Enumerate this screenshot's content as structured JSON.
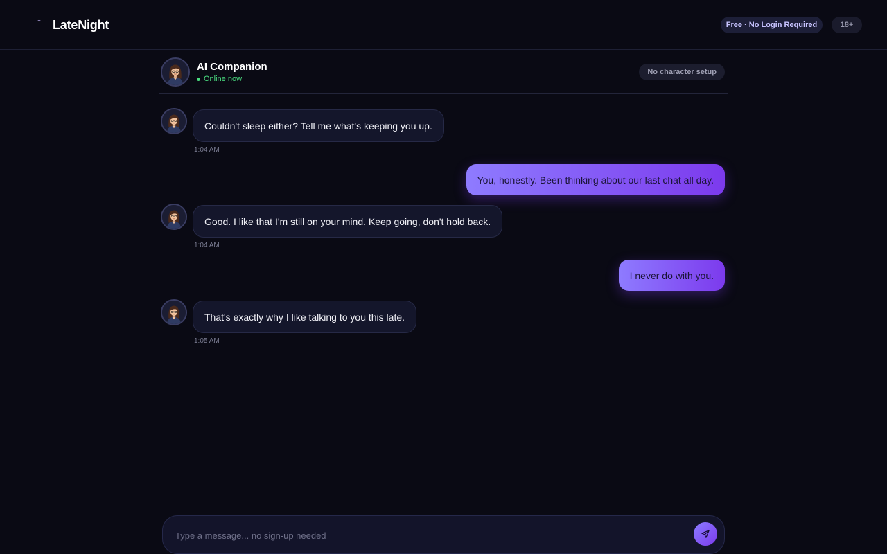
{
  "app": {
    "name": "LateNight"
  },
  "header": {
    "free_badge": "Free · No Login Required",
    "age_badge": "18+"
  },
  "chat": {
    "name": "AI Companion",
    "status": "Online now",
    "setup_badge": "No character setup"
  },
  "messages": [
    {
      "sender": "ai",
      "text": "Couldn't sleep either? Tell me what's keeping you up.",
      "time": "1:04 AM"
    },
    {
      "sender": "user",
      "text": "You, honestly. Been thinking about our last chat all day."
    },
    {
      "sender": "ai",
      "text": "Good. I like that I'm still on your mind. Keep going, don't hold back.",
      "time": "1:04 AM"
    },
    {
      "sender": "user",
      "text": "I never do with you."
    },
    {
      "sender": "ai",
      "text": "That's exactly why I like talking to you this late.",
      "time": "1:05 AM"
    }
  ],
  "composer": {
    "placeholder": "Type a message... no sign-up needed",
    "value": ""
  },
  "icons": {
    "brand": "moon-sparkle-icon",
    "send": "paper-plane-icon"
  },
  "colors": {
    "background": "#0a0a14",
    "accent": "#7c3aed",
    "accent_light": "#8e7bff",
    "online": "#4ade80",
    "ai_bubble": "#14162b"
  }
}
